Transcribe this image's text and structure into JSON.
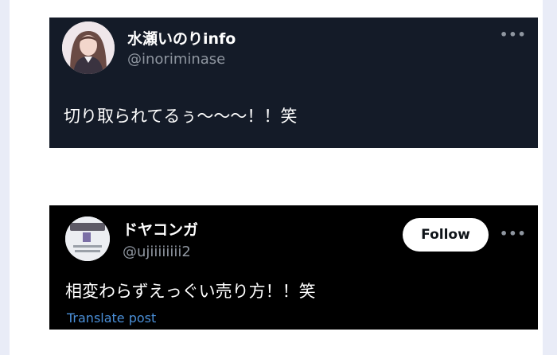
{
  "posts": [
    {
      "display_name": "水瀬いのりinfo",
      "handle": "@inoriminase",
      "text": "切り取られてるぅ〜〜〜！！笑",
      "avatar_icon": "profile-photo-icon"
    },
    {
      "display_name": "ドヤコンガ",
      "handle": "@ujiiiiiiii2",
      "text": "相変わらずえっぐい売り方！！笑",
      "follow_label": "Follow",
      "translate_label": "Translate post",
      "avatar_icon": "profile-photo-icon"
    }
  ],
  "more_icon": "more-options-icon",
  "colors": {
    "card1_bg": "#141b28",
    "card2_bg": "#000000",
    "handle": "#8f96a0",
    "link": "#4a8fd8"
  }
}
